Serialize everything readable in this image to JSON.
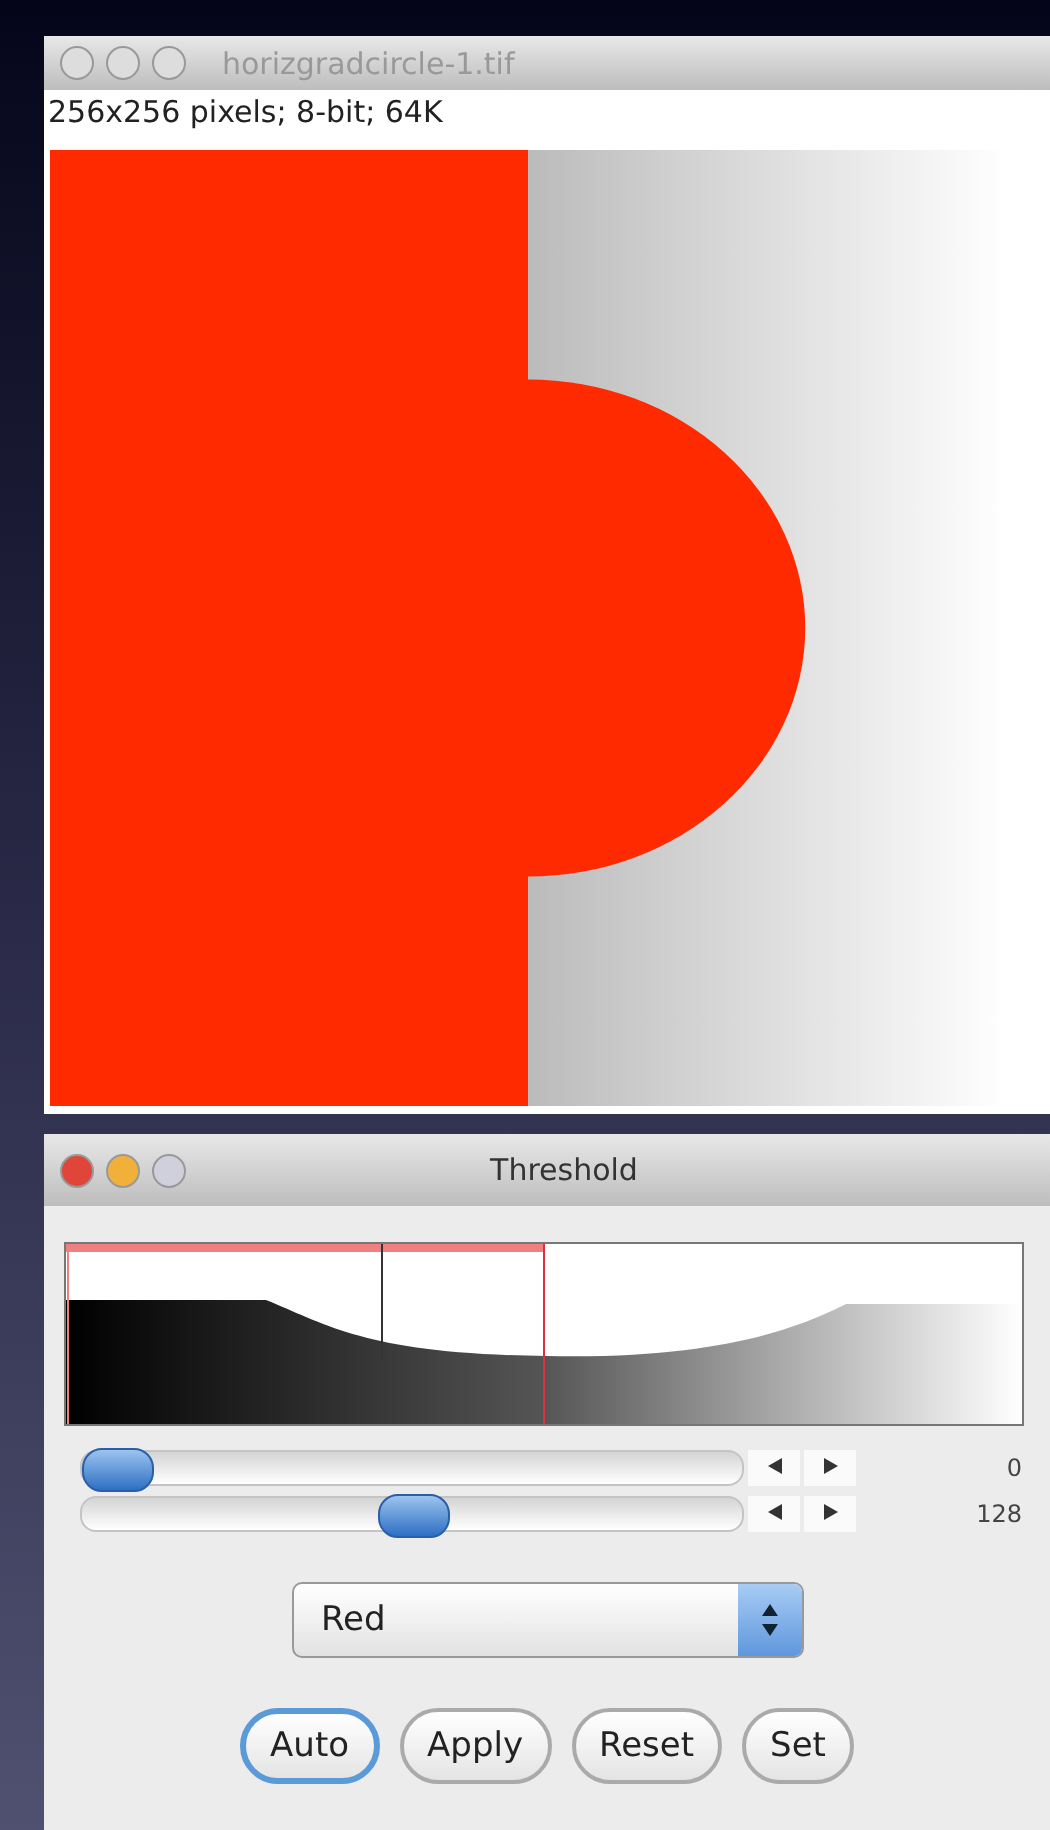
{
  "image_window": {
    "title": "horizgradcircle-1.tif",
    "active": false,
    "info": "256x256 pixels; 8-bit; 64K"
  },
  "threshold_window": {
    "title": "Threshold",
    "active": true,
    "sliders": [
      {
        "level": 0,
        "reading": "0"
      },
      {
        "level": 0.5,
        "reading": "128"
      }
    ],
    "dropdown": {
      "value": "Red"
    },
    "buttons": [
      {
        "label": "Auto",
        "default": true
      },
      {
        "label": "Apply",
        "default": false
      },
      {
        "label": "Reset",
        "default": false
      },
      {
        "label": "Set",
        "default": false
      }
    ]
  }
}
